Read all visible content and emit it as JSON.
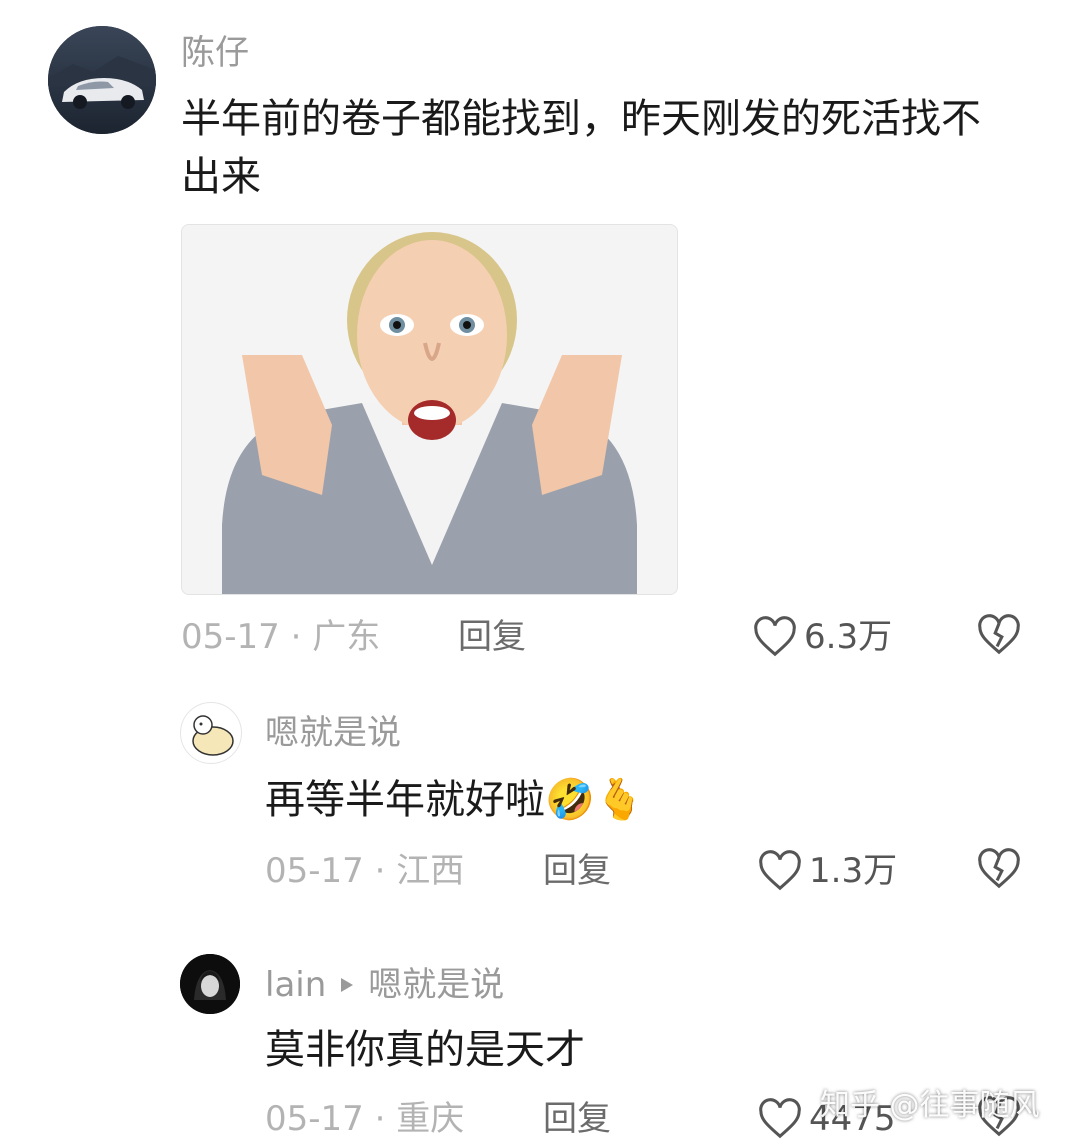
{
  "comments": [
    {
      "username": "陈仔",
      "text": "半年前的卷子都能找到，昨天刚发的死活找不出来",
      "meta": "05-17 · 广东",
      "reply_label": "回复",
      "likes": "6.3万"
    },
    {
      "username": "嗯就是说",
      "text": "再等半年就好啦",
      "emojis": [
        "🤣",
        "🫰"
      ],
      "meta": "05-17 · 江西",
      "reply_label": "回复",
      "likes": "1.3万"
    },
    {
      "username": "lain",
      "reply_to": "嗯就是说",
      "text": "莫非你真的是天才",
      "meta": "05-17 · 重庆",
      "reply_label": "回复",
      "likes": "4475"
    }
  ],
  "watermark": "知乎 @往事随风",
  "colors": {
    "username": "#9a9a9a",
    "text": "#1a1a1a",
    "meta": "#b3b3b3",
    "icon": "#555555"
  }
}
